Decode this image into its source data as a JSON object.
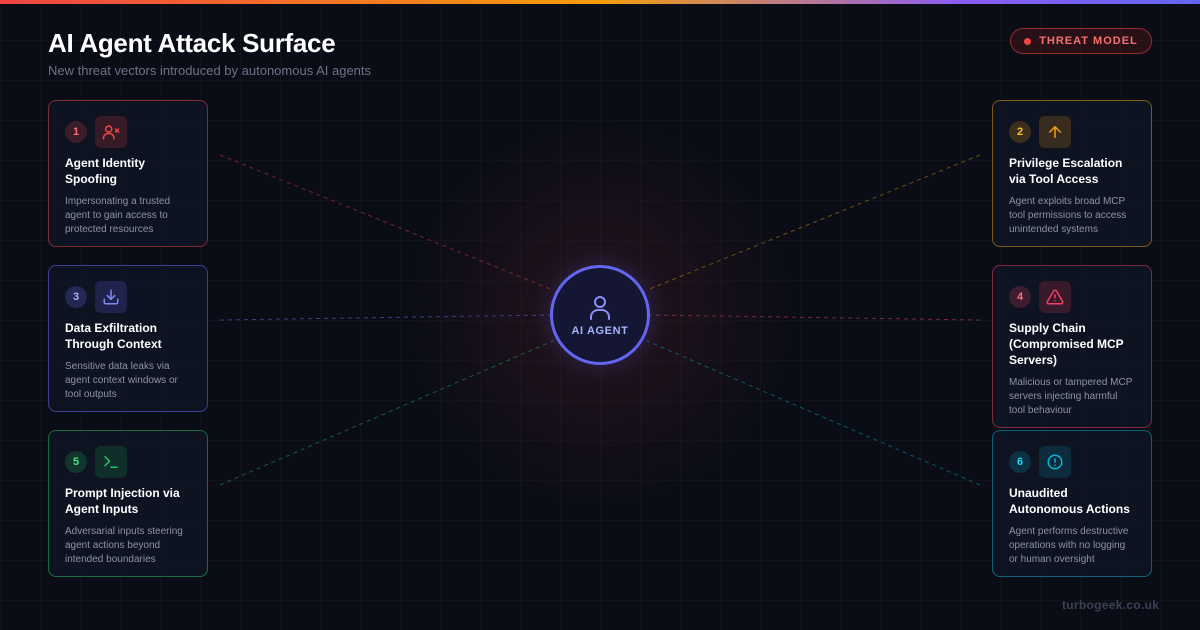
{
  "header": {
    "title": "AI Agent Attack Surface",
    "subtitle": "New threat vectors introduced by autonomous AI agents"
  },
  "badge": {
    "label": "THREAT MODEL",
    "color": "#ef4444"
  },
  "hub": {
    "label": "AI AGENT",
    "icon": "user-icon",
    "color": "#6366f1"
  },
  "threats": [
    {
      "number": "1",
      "title": "Agent Identity Spoofing",
      "description": "Impersonating a trusted agent to gain access to protected resources",
      "icon": "user-x-icon",
      "color": "#ef4444"
    },
    {
      "number": "2",
      "title": "Privilege Escalation via Tool Access",
      "description": "Agent exploits broad MCP tool permissions to access unintended systems",
      "icon": "arrow-up-icon",
      "color": "#f59e0b"
    },
    {
      "number": "3",
      "title": "Data Exfiltration Through Context",
      "description": "Sensitive data leaks via agent context windows or tool outputs",
      "icon": "download-icon",
      "color": "#6366f1"
    },
    {
      "number": "4",
      "title": "Supply Chain (Compromised MCP Servers)",
      "description": "Malicious or tampered MCP servers injecting harmful tool behaviour",
      "icon": "warning-icon",
      "color": "#f43f5e"
    },
    {
      "number": "5",
      "title": "Prompt Injection via Agent Inputs",
      "description": "Adversarial inputs steering agent actions beyond intended boundaries",
      "icon": "terminal-icon",
      "color": "#22c55e"
    },
    {
      "number": "6",
      "title": "Unaudited Autonomous Actions",
      "description": "Agent performs destructive operations with no logging or human oversight",
      "icon": "alert-circle-icon",
      "color": "#06b6d4"
    }
  ],
  "footer": {
    "text": "turbogeek.co.uk"
  }
}
